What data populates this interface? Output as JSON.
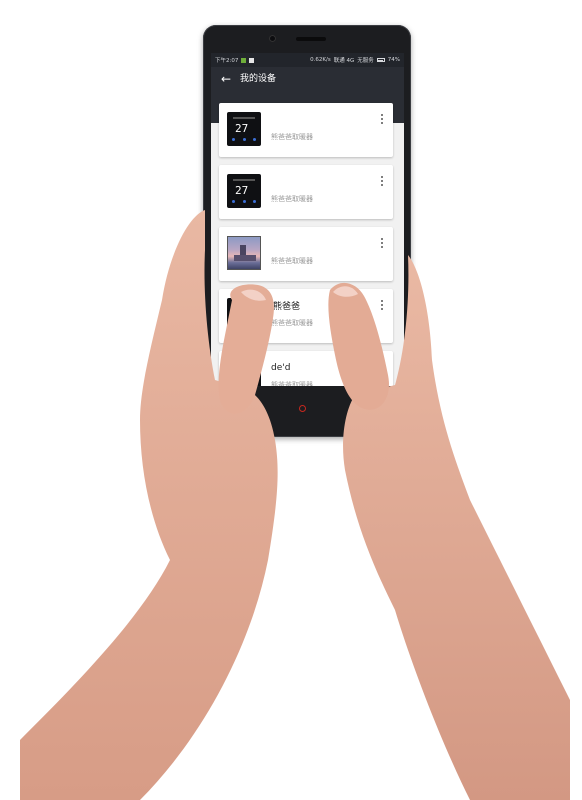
{
  "status_bar": {
    "time": "下午2:07",
    "network_speed": "0.62K/s",
    "carrier": "联通 4G",
    "wifi": "无服务",
    "battery": "74%"
  },
  "app_bar": {
    "back_icon": "arrow-left-icon",
    "title": "我的设备"
  },
  "devices": [
    {
      "name": "",
      "type": "熊爸爸取暖器",
      "display": "27",
      "thumb": "thermostat"
    },
    {
      "name": "",
      "type": "熊爸爸取暖器",
      "display": "27",
      "thumb": "thermostat"
    },
    {
      "name": "",
      "type": "熊爸爸取暖器",
      "thumb": "photo"
    },
    {
      "name": "熊爸爸",
      "type": "熊爸爸取暖器",
      "thumb": "thermostat"
    },
    {
      "name": "de'd",
      "type": "熊爸爸取暖器",
      "thumb": "thermostat"
    }
  ],
  "colors": {
    "app_bar": "#2a2d34",
    "status_bar": "#22252b",
    "accent": "#3c6fd6",
    "home_button": "#c6271e"
  }
}
